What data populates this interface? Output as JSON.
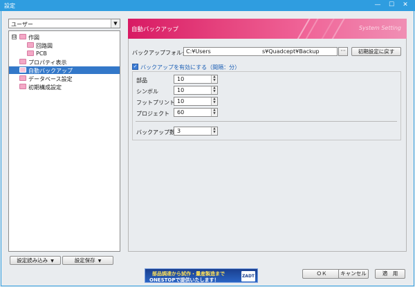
{
  "window": {
    "title": "設定",
    "minimize": "—",
    "maximize": "☐",
    "close": "✕"
  },
  "preset": {
    "value": "ユーザー",
    "arrow": "▼"
  },
  "tree": [
    {
      "label": "作図",
      "expander": "⊟"
    },
    {
      "label": "回路図"
    },
    {
      "label": "PCB"
    },
    {
      "label": "プロパティ表示"
    },
    {
      "label": "自動バックアップ",
      "selected": true
    },
    {
      "label": "データベース設定"
    },
    {
      "label": "初期構成設定"
    }
  ],
  "left_buttons": {
    "load": "設定読み込み",
    "save": "設定保存",
    "dd": "▼"
  },
  "banner": {
    "title": "自動バックアップ",
    "subtitle": "System Setting",
    "color": "#d81a63"
  },
  "backup": {
    "folder_label": "バックアップフォルダ",
    "folder_value_a": "C:¥Users",
    "folder_value_b": "s¥Quadcept¥Backup",
    "browse": "···",
    "reset": "初期設定に戻す",
    "enable_label": "バックアップを有効にする（間隔：分）",
    "enable_checked": "✓"
  },
  "intervals": [
    {
      "label": "部品",
      "value": "10"
    },
    {
      "label": "シンボル",
      "value": "10"
    },
    {
      "label": "フットプリント",
      "value": "10"
    },
    {
      "label": "プロジェクト",
      "value": "60"
    }
  ],
  "count": {
    "label": "バックアップ数",
    "value": "3"
  },
  "spin": {
    "up": "▲",
    "down": "▼"
  },
  "ad": {
    "line1": "部品調達から試作・量産製造まで",
    "line2": "ONESTOPで提供いたします！",
    "logo": "ZADT"
  },
  "dialog": {
    "ok": "ＯＫ",
    "cancel": "キャンセル",
    "apply": "適　用"
  }
}
